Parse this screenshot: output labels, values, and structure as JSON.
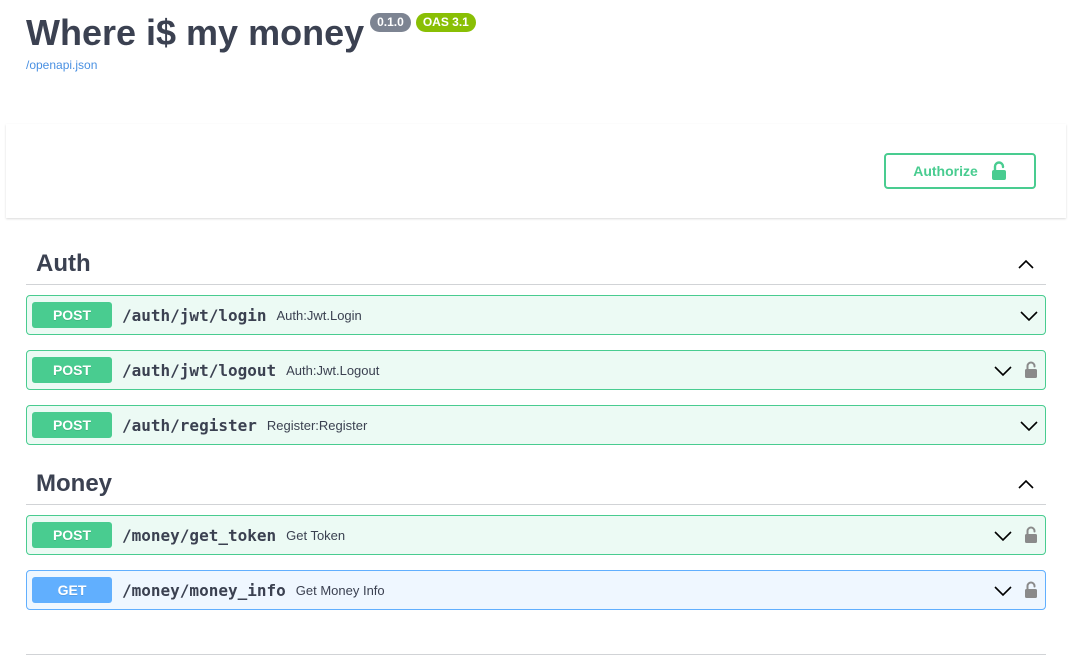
{
  "info": {
    "title": "Where i$ my money",
    "version": "0.1.0",
    "oas": "OAS 3.1",
    "spec_link": "/openapi.json"
  },
  "authorize": {
    "label": "Authorize",
    "icon": "unlock-icon"
  },
  "colors": {
    "post": "#49cc90",
    "get": "#61affe",
    "text": "#3b4151"
  },
  "tags": [
    {
      "name": "Auth",
      "expanded": true,
      "operations": [
        {
          "method": "POST",
          "path": "/auth/jwt/login",
          "summary": "Auth:Jwt.Login",
          "locked": false
        },
        {
          "method": "POST",
          "path": "/auth/jwt/logout",
          "summary": "Auth:Jwt.Logout",
          "locked": true
        },
        {
          "method": "POST",
          "path": "/auth/register",
          "summary": "Register:Register",
          "locked": false
        }
      ]
    },
    {
      "name": "Money",
      "expanded": true,
      "operations": [
        {
          "method": "POST",
          "path": "/money/get_token",
          "summary": "Get Token",
          "locked": true
        },
        {
          "method": "GET",
          "path": "/money/money_info",
          "summary": "Get Money Info",
          "locked": true
        }
      ]
    }
  ]
}
